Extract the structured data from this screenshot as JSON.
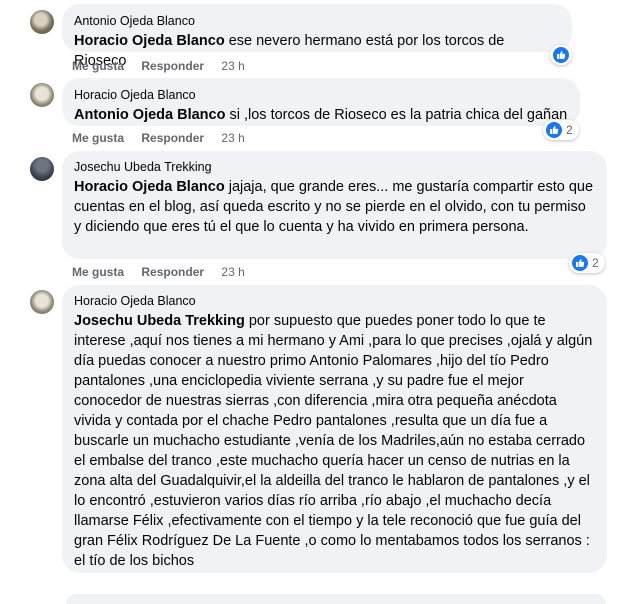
{
  "comments": [
    {
      "author": "Antonio Ojeda Blanco",
      "mention": "Horacio Ojeda Blanco",
      "text": " ese nevero hermano está por los torcos de Rioseco",
      "like_label": "Me gusta",
      "reply_label": "Responder",
      "time": "23 h",
      "reaction_icon": "like-icon"
    },
    {
      "author": "Horacio Ojeda Blanco",
      "mention": "Antonio Ojeda Blanco",
      "text": " si ,los torcos de Rioseco es la patria chica del gañan",
      "like_label": "Me gusta",
      "reply_label": "Responder",
      "time": "23 h",
      "reaction_icon": "like-icon",
      "reaction_count": "2"
    },
    {
      "author": "Josechu Ubeda Trekking",
      "mention": "Horacio Ojeda Blanco",
      "text": " jajaja, que grande eres... me gustaría compartir esto que cuentas en el blog, así queda escrito y no se pierde en el olvido, con tu permiso y diciendo que eres tú el que lo cuenta y ha vivido en primera persona.",
      "like_label": "Me gusta",
      "reply_label": "Responder",
      "time": "23 h",
      "reaction_icon": "like-icon",
      "reaction_count": "2"
    },
    {
      "author": "Horacio Ojeda Blanco",
      "mention": "Josechu Ubeda Trekking",
      "text": " por supuesto que puedes poner todo lo que te interese ,aquí nos tienes a mi hermano y Ami ,para lo que precises ,ojalá y algún día puedas conocer a nuestro primo Antonio Palomares ,hijo del tío Pedro pantalones ,una enciclopedia viviente serrana ,y su padre fue el mejor conocedor de nuestras sierras ,con diferencia ,mira otra pequeña anécdota vivida y contada por el chache Pedro pantalones ,resulta que un día fue a buscarle un muchacho estudiante ,venía de los Madriles,aún no estaba cerrado el embalse del tranco ,este muchacho quería hacer un censo de nutrias en la zona alta del Guadalquivir,el la aldeilla del tranco le hablaron de pantalones ,y el lo encontró ,estuvieron varios días río arriba ,río abajo ,el muchacho decía llamarse Félix ,efectivamente con el tiempo y la tele reconoció que fue guía del gran Félix Rodríguez De La Fuente ,o como lo mentabamos todos los serranos : el tío de los bichos"
    }
  ],
  "colors": {
    "bubble": "#f0f2f5",
    "like_blue": "#1877f2",
    "meta_gray": "#65676b"
  }
}
